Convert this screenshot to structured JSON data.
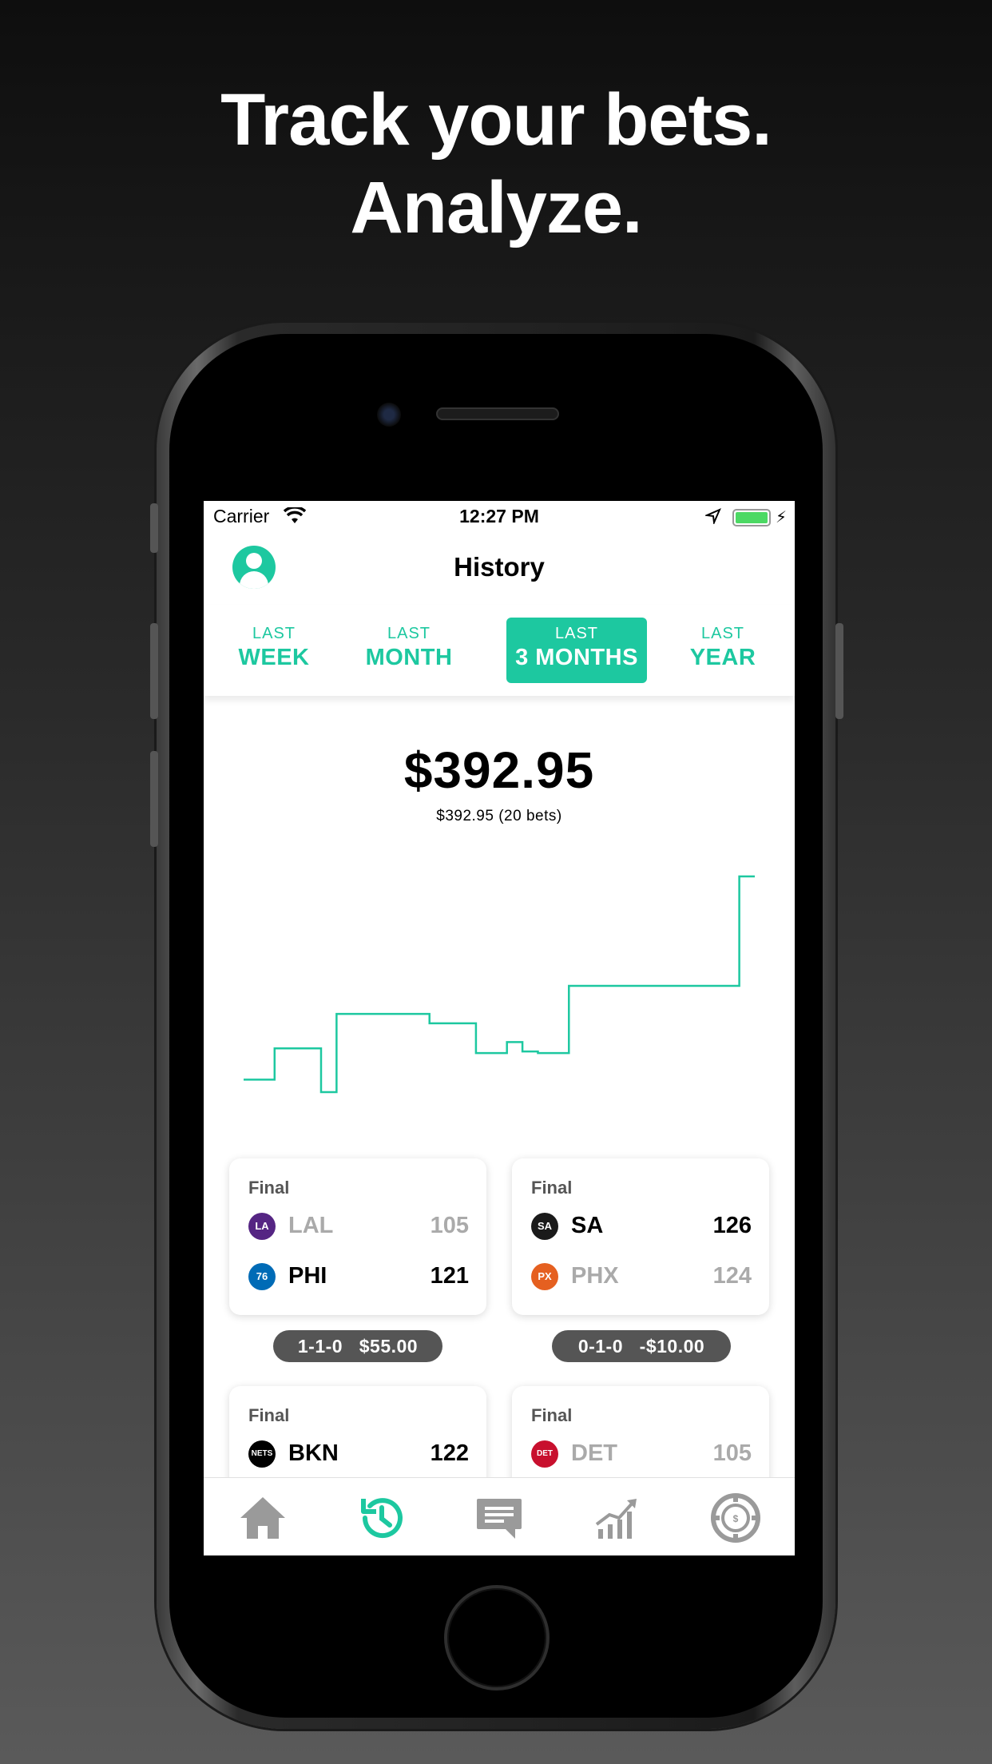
{
  "headline": {
    "line1": "Track your bets.",
    "line2": "Analyze."
  },
  "status_bar": {
    "carrier": "Carrier",
    "time": "12:27 PM",
    "icons": [
      "wifi-icon",
      "location-icon",
      "battery-icon",
      "charging-icon"
    ]
  },
  "nav": {
    "title": "History",
    "left_icon": "profile-icon"
  },
  "period_tabs": [
    {
      "top": "LAST",
      "bottom": "WEEK",
      "active": false
    },
    {
      "top": "LAST",
      "bottom": "MONTH",
      "active": false
    },
    {
      "top": "LAST",
      "bottom": "3 MONTHS",
      "active": true
    },
    {
      "top": "LAST",
      "bottom": "YEAR",
      "active": false
    }
  ],
  "summary": {
    "total": "$392.95",
    "detail": "$392.95 (20 bets)"
  },
  "chart_data": {
    "type": "line",
    "title": "",
    "xlabel": "",
    "ylabel": "",
    "grid": false,
    "series": [
      {
        "values": [
          -12,
          -12,
          8,
          8,
          8,
          -20,
          30,
          30,
          30,
          30,
          30,
          30,
          24,
          24,
          24,
          5,
          5,
          12,
          6,
          5,
          5,
          48,
          48,
          48,
          48,
          48,
          48,
          48,
          48,
          48,
          48,
          48,
          118,
          118
        ]
      }
    ],
    "colors": {
      "line": "#1dc8a0"
    }
  },
  "games": [
    {
      "status": "Final",
      "teams": [
        {
          "abbr": "LAL",
          "score": "105",
          "result": "lose",
          "logo_color": "#552583",
          "logo_text": "LA"
        },
        {
          "abbr": "PHI",
          "score": "121",
          "result": "win",
          "logo_color": "#006bb6",
          "logo_text": "76"
        }
      ],
      "record": "1-1-0   $55.00"
    },
    {
      "status": "Final",
      "teams": [
        {
          "abbr": "SA",
          "score": "126",
          "result": "win",
          "logo_color": "#1a1a1a",
          "logo_text": "SA"
        },
        {
          "abbr": "PHX",
          "score": "124",
          "result": "lose",
          "logo_color": "#e56020",
          "logo_text": "PX"
        }
      ],
      "record": "0-1-0   -$10.00"
    },
    {
      "status": "Final",
      "teams": [
        {
          "abbr": "BKN",
          "score": "122",
          "result": "win",
          "logo_color": "#000000",
          "logo_text": "NETS"
        }
      ],
      "record": ""
    },
    {
      "status": "Final",
      "teams": [
        {
          "abbr": "DET",
          "score": "105",
          "result": "lose",
          "logo_color": "#c8102e",
          "logo_text": "DET"
        }
      ],
      "record": ""
    }
  ],
  "tabbar": [
    {
      "icon": "home-icon",
      "active": false
    },
    {
      "icon": "history-icon",
      "active": true
    },
    {
      "icon": "chat-icon",
      "active": false
    },
    {
      "icon": "stats-icon",
      "active": false
    },
    {
      "icon": "chip-icon",
      "active": false
    }
  ],
  "colors": {
    "accent": "#1dc8a0",
    "inactive": "#9a9a9a",
    "pill": "#555555"
  }
}
